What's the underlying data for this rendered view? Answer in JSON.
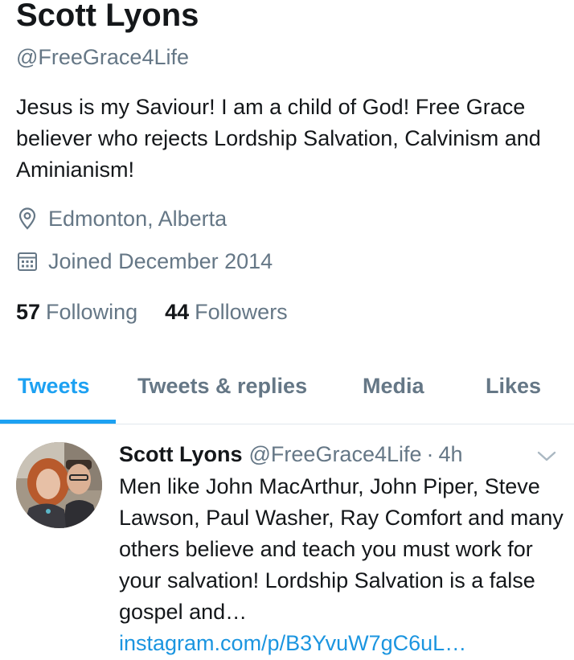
{
  "profile": {
    "display_name": "Scott Lyons",
    "handle": "@FreeGrace4Life",
    "bio": "Jesus is my Saviour! I am a child of God! Free Grace believer who rejects Lordship Salvation, Calvinism and Aminianism!",
    "location": "Edmonton, Alberta",
    "joined": "Joined December 2014",
    "following_count": "57",
    "following_label": "Following",
    "followers_count": "44",
    "followers_label": "Followers",
    "location_icon": "location-pin-icon",
    "joined_icon": "calendar-icon"
  },
  "tabs": [
    {
      "label": "Tweets",
      "active": true
    },
    {
      "label": "Tweets & replies",
      "active": false
    },
    {
      "label": "Media",
      "active": false
    },
    {
      "label": "Likes",
      "active": false
    }
  ],
  "tweet": {
    "author": "Scott Lyons",
    "handle": "@FreeGrace4Life",
    "separator": "·",
    "time": "4h",
    "text": "Men like John MacArthur, John Piper, Steve Lawson, Paul Washer, Ray Comfort and many others believe and teach you must work for your salvation! Lordship Salvation is a false gospel and…",
    "link": "instagram.com/p/B3YvuW7gC6uL…",
    "avatar_icon": "avatar",
    "menu_icon": "chevron-down-icon"
  },
  "colors": {
    "accent": "#1da1f2",
    "link": "#1b95e0",
    "secondary_text": "#657786",
    "primary_text": "#14171a",
    "divider": "#e1e8ed"
  }
}
